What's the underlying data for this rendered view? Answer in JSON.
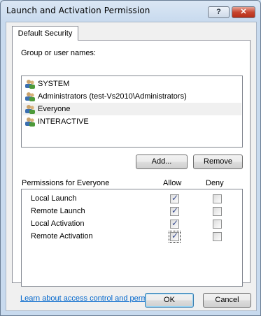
{
  "window": {
    "title": "Launch and Activation Permission",
    "help_label": "?",
    "close_label": "✕"
  },
  "tab": {
    "label": "Default Security"
  },
  "groups": {
    "label": "Group or user names:",
    "items": [
      {
        "name": "SYSTEM",
        "icon": "users-icon",
        "selected": false
      },
      {
        "name": "Administrators (test-Vs2010\\Administrators)",
        "icon": "users-icon",
        "selected": false
      },
      {
        "name": "Everyone",
        "icon": "users-icon",
        "selected": true
      },
      {
        "name": "INTERACTIVE",
        "icon": "users-icon",
        "selected": false
      }
    ]
  },
  "buttons": {
    "add": "Add...",
    "remove": "Remove",
    "ok": "OK",
    "cancel": "Cancel"
  },
  "permissions": {
    "header": "Permissions for Everyone",
    "allow_label": "Allow",
    "deny_label": "Deny",
    "rows": [
      {
        "name": "Local Launch",
        "allow": true,
        "deny": false
      },
      {
        "name": "Remote Launch",
        "allow": true,
        "deny": false
      },
      {
        "name": "Local Activation",
        "allow": true,
        "deny": false
      },
      {
        "name": "Remote Activation",
        "allow": true,
        "deny": false
      }
    ]
  },
  "link": {
    "text": "Learn about access control and permissions"
  }
}
